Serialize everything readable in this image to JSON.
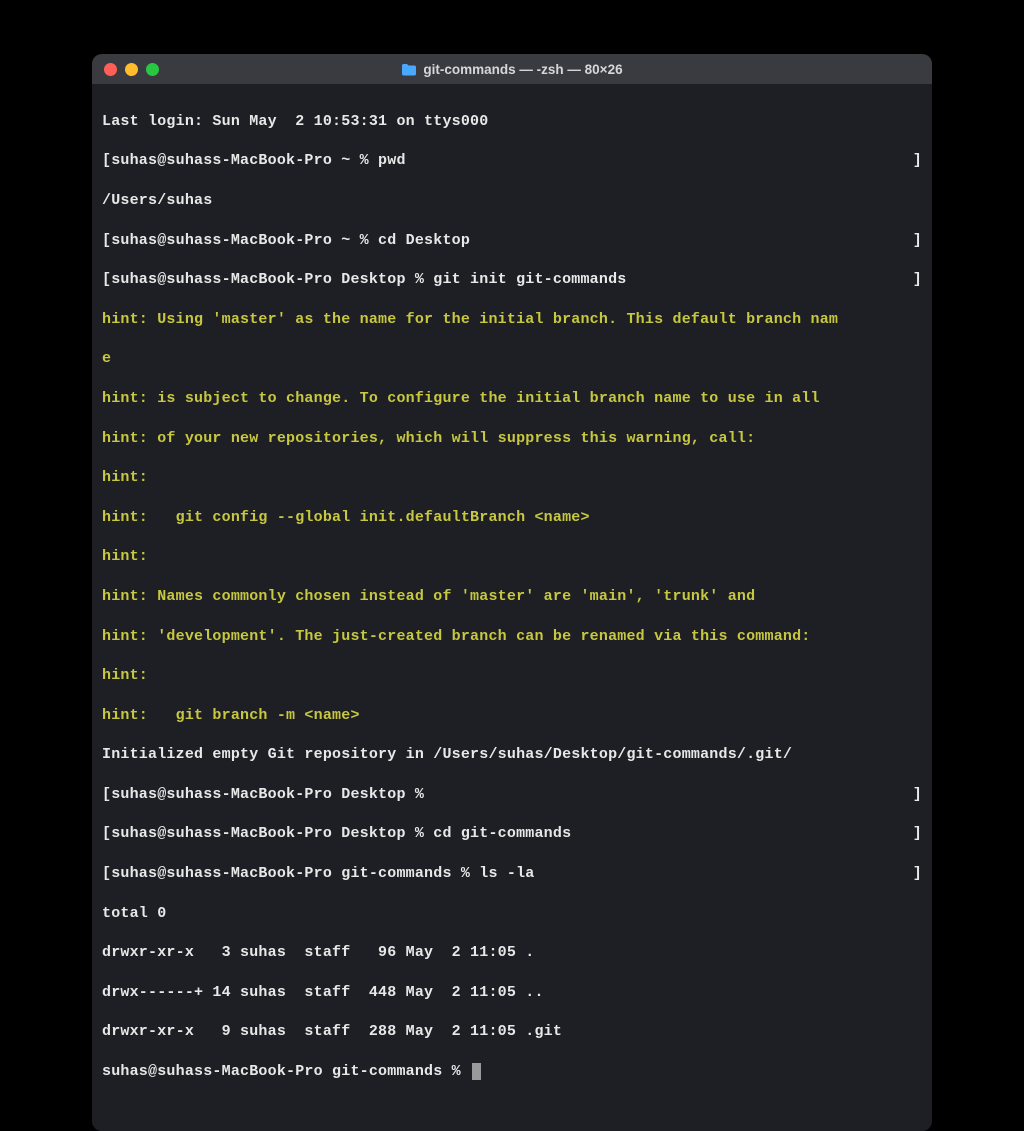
{
  "colors": {
    "bg": "#000000",
    "window_bg": "#1e1f24",
    "titlebar_bg": "#3a3b40",
    "text": "#e8e8e8",
    "hint": "#c7c83f",
    "close": "#ff5f57",
    "minimize": "#febc2e",
    "zoom": "#28c840"
  },
  "title": "git-commands — -zsh — 80×26",
  "lines": {
    "l0": "Last login: Sun May  2 10:53:31 on ttys000",
    "l1_left": "[suhas@suhass-MacBook-Pro ~ % pwd",
    "l1_right": "]",
    "l2": "/Users/suhas",
    "l3_left": "[suhas@suhass-MacBook-Pro ~ % cd Desktop",
    "l3_right": "]",
    "l4_left": "[suhas@suhass-MacBook-Pro Desktop % git init git-commands",
    "l4_right": "]",
    "l5": "hint: Using 'master' as the name for the initial branch. This default branch nam",
    "l6": "e",
    "l7": "hint: is subject to change. To configure the initial branch name to use in all ",
    "l8": "hint: of your new repositories, which will suppress this warning, call:",
    "l9": "hint: ",
    "l10": "hint:   git config --global init.defaultBranch <name>",
    "l11": "hint: ",
    "l12": "hint: Names commonly chosen instead of 'master' are 'main', 'trunk' and ",
    "l13": "hint: 'development'. The just-created branch can be renamed via this command:",
    "l14": "hint: ",
    "l15": "hint:   git branch -m <name>",
    "l16": "Initialized empty Git repository in /Users/suhas/Desktop/git-commands/.git/",
    "l17_left": "[suhas@suhass-MacBook-Pro Desktop % ",
    "l17_right": "]",
    "l18_left": "[suhas@suhass-MacBook-Pro Desktop % cd git-commands",
    "l18_right": "]",
    "l19_left": "[suhas@suhass-MacBook-Pro git-commands % ls -la",
    "l19_right": "]",
    "l20": "total 0",
    "l21": "drwxr-xr-x   3 suhas  staff   96 May  2 11:05 .",
    "l22": "drwx------+ 14 suhas  staff  448 May  2 11:05 ..",
    "l23": "drwxr-xr-x   9 suhas  staff  288 May  2 11:05 .git",
    "l24": "suhas@suhass-MacBook-Pro git-commands % "
  }
}
